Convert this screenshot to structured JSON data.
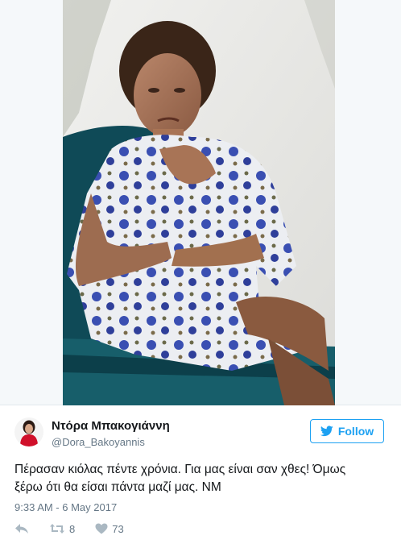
{
  "tweet": {
    "author": {
      "display_name": "Ντόρα Μπακογιάννη",
      "screen_name": "@Dora_Bakoyannis",
      "avatar": "avatar-photo"
    },
    "follow_button": {
      "label": "Follow",
      "icon": "bird-icon"
    },
    "text_lines": [
      "Πέρασαν κιόλας πέντε χρόνια. Για μας είναι σαν χθες! Όμως",
      "ξέρω ότι θα είσαι πάντα μαζί μας. ΝΜ"
    ],
    "timestamp": "9:33 AM - 6 May 2017",
    "actions": {
      "reply": {
        "icon": "reply-icon"
      },
      "retweet": {
        "icon": "retweet-icon",
        "count": "8"
      },
      "like": {
        "icon": "heart-icon",
        "count": "73"
      }
    },
    "media": {
      "type": "photo"
    }
  },
  "colors": {
    "accent": "#1da1f2",
    "text": "#14171a",
    "secondary_text": "#657786",
    "icon": "#aab8c2",
    "border": "#e1e8ed"
  }
}
